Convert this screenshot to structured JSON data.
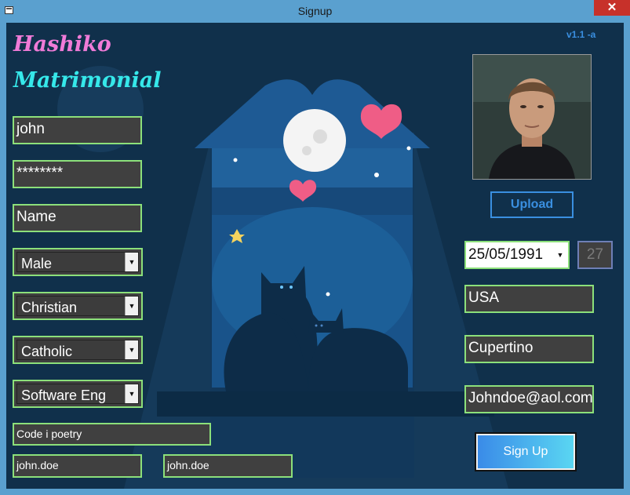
{
  "window": {
    "title": "Signup",
    "close_glyph": "✕",
    "icon": "app-window-icon"
  },
  "branding": {
    "line1": "Hashiko",
    "line2": "Matrimonial",
    "version": "v1.1 -a",
    "colors": {
      "line1": "#f07bd8",
      "line2": "#36e8ea",
      "version": "#3a8fe0"
    }
  },
  "form": {
    "username": "john",
    "password": "********",
    "name": "Name",
    "gender": "Male",
    "religion": "Christian",
    "denomination": "Catholic",
    "profession": "Software Eng",
    "hobby": "Code i poetry",
    "field_left": "john.doe",
    "field_right": "john.doe",
    "dob": "25/05/1991",
    "age": "27",
    "country": "USA",
    "city": "Cupertino",
    "email": "Johndoe@aol.com"
  },
  "buttons": {
    "upload": "Upload",
    "signup": "Sign Up"
  },
  "colors": {
    "background": "#10304b",
    "field_border": "#8ce07a",
    "field_bg": "#404040",
    "accent": "#3a8fe0"
  }
}
